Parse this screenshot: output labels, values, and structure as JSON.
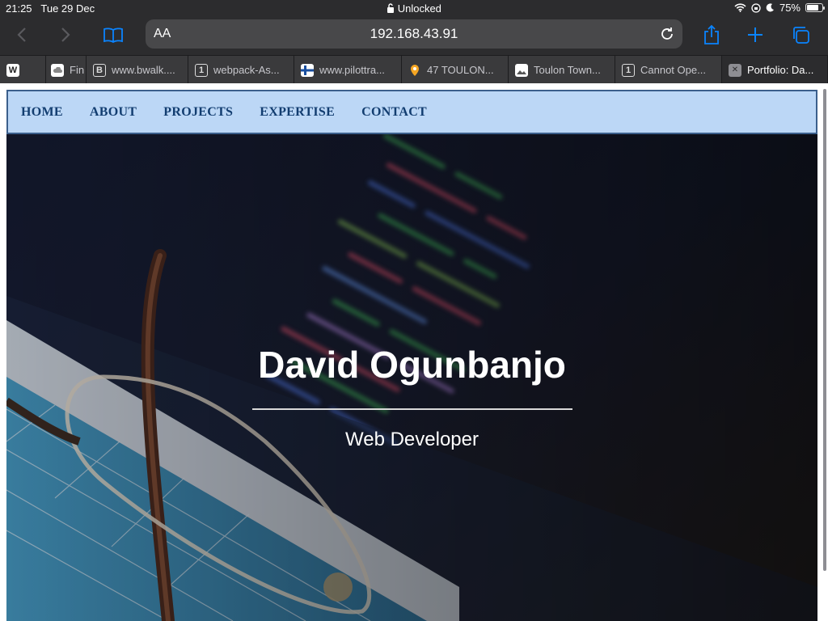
{
  "status_bar": {
    "time": "21:25",
    "date": "Tue 29 Dec",
    "lock_status": "Unlocked",
    "battery": "75%",
    "battery_level": 0.75
  },
  "toolbar": {
    "aa_label": "AA",
    "url": "192.168.43.91"
  },
  "tabs": [
    {
      "favicon": "W",
      "label": ""
    },
    {
      "favicon": "cloud",
      "label": "Fin"
    },
    {
      "favicon": "B",
      "label": "www.bwalk...."
    },
    {
      "favicon": "1",
      "label": "webpack-As..."
    },
    {
      "favicon": "flag",
      "label": "www.pilottra..."
    },
    {
      "favicon": "pin",
      "label": "47 TOULON..."
    },
    {
      "favicon": "image",
      "label": "Toulon Town..."
    },
    {
      "favicon": "1",
      "label": "Cannot Ope..."
    },
    {
      "favicon": "close",
      "label": "Portfolio: Da..."
    }
  ],
  "nav": {
    "items": [
      "HOME",
      "ABOUT",
      "PROJECTS",
      "EXPERTISE",
      "CONTACT"
    ]
  },
  "hero": {
    "title": "David Ogunbanjo",
    "subtitle": "Web Developer"
  },
  "colors": {
    "nav_bg": "#bcd7f6",
    "nav_text": "#123d70",
    "ios_blue": "#0a84ff"
  }
}
